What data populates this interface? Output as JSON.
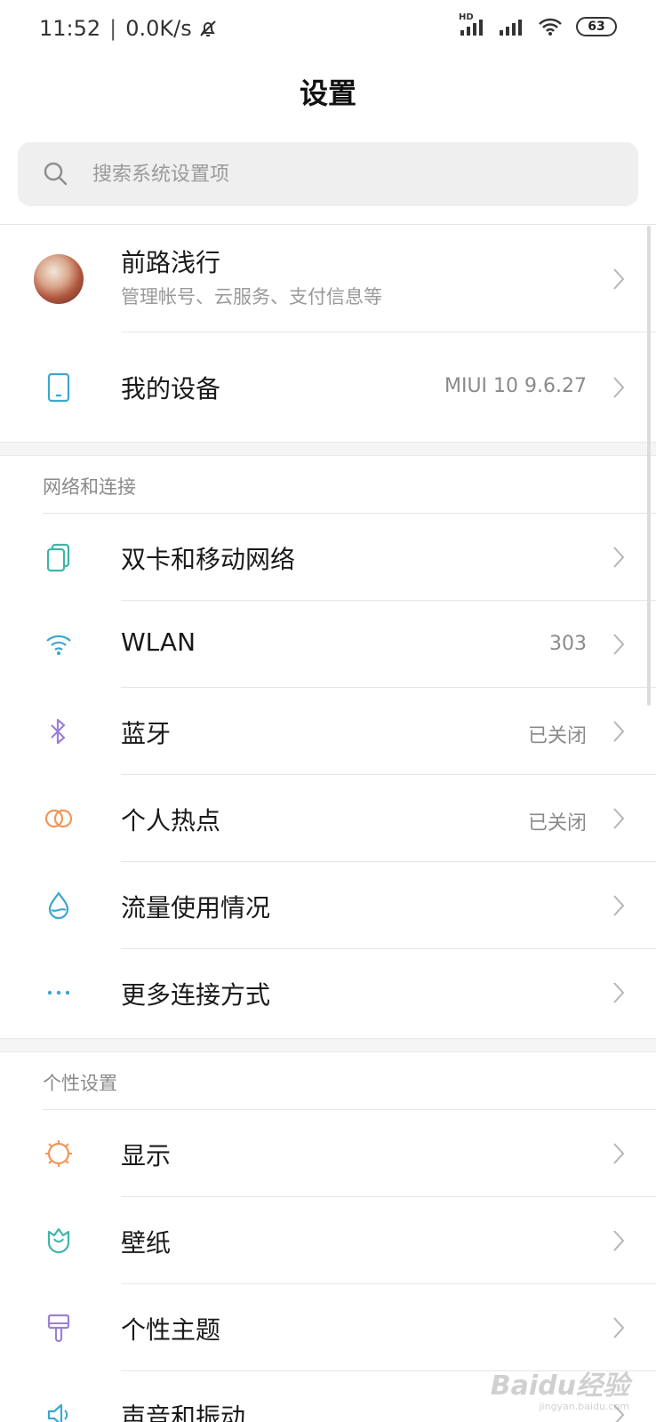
{
  "status_bar": {
    "time": "11:52",
    "net_speed": "0.0K/s",
    "battery": "63",
    "hd_label": "HD"
  },
  "page": {
    "title": "设置"
  },
  "search": {
    "placeholder": "搜索系统设置项"
  },
  "profile": {
    "name": "前路浅行",
    "subtitle": "管理帐号、云服务、支付信息等"
  },
  "device": {
    "label": "我的设备",
    "value": "MIUI 10 9.6.27"
  },
  "sections": [
    {
      "header": "网络和连接",
      "items": [
        {
          "label": "双卡和移动网络",
          "value": "",
          "icon": "dual-sim-icon",
          "color": "#3fb4a6"
        },
        {
          "label": "WLAN",
          "value": "303",
          "icon": "wifi-icon",
          "color": "#3aa7d0"
        },
        {
          "label": "蓝牙",
          "value": "已关闭",
          "icon": "bluetooth-icon",
          "color": "#9c7fd6"
        },
        {
          "label": "个人热点",
          "value": "已关闭",
          "icon": "hotspot-icon",
          "color": "#f0965a"
        },
        {
          "label": "流量使用情况",
          "value": "",
          "icon": "data-usage-icon",
          "color": "#3aa7d0"
        },
        {
          "label": "更多连接方式",
          "value": "",
          "icon": "more-icon",
          "color": "#3aa7d0"
        }
      ]
    },
    {
      "header": "个性设置",
      "items": [
        {
          "label": "显示",
          "value": "",
          "icon": "display-icon",
          "color": "#f0965a"
        },
        {
          "label": "壁纸",
          "value": "",
          "icon": "wallpaper-icon",
          "color": "#3fb4a6"
        },
        {
          "label": "个性主题",
          "value": "",
          "icon": "theme-icon",
          "color": "#9c7fd6"
        },
        {
          "label": "声音和振动",
          "value": "",
          "icon": "sound-icon",
          "color": "#3aa7d0"
        }
      ]
    }
  ],
  "watermark": {
    "text": "Baidu经验",
    "sub": "jingyan.baidu.com"
  }
}
